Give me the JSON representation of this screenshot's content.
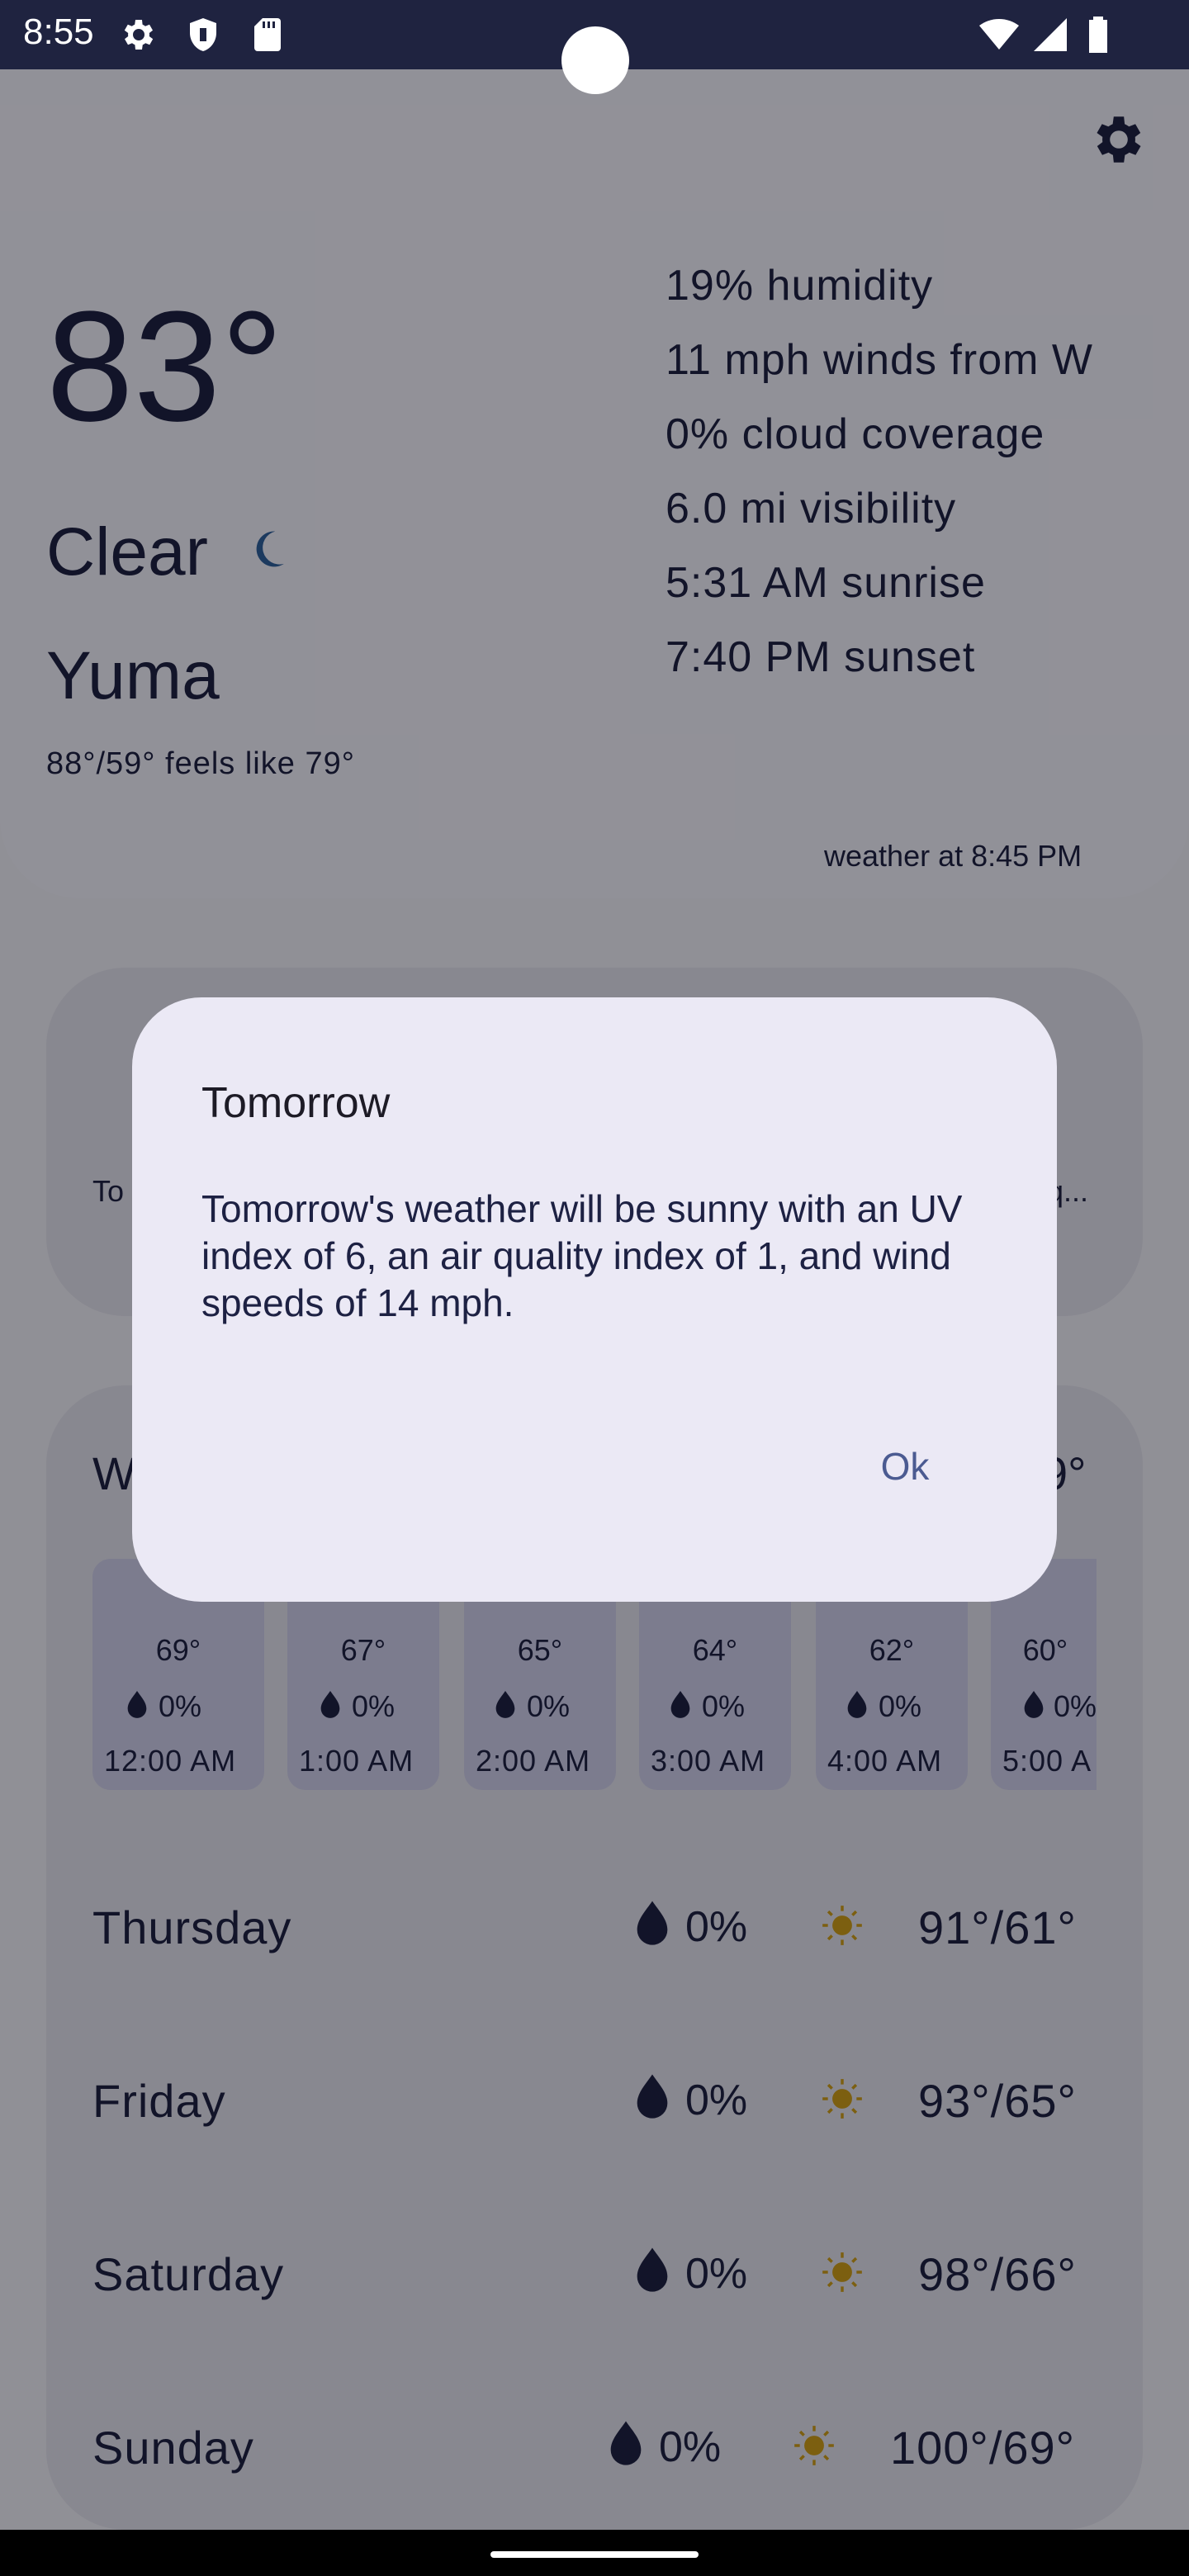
{
  "status_bar": {
    "time": "8:55",
    "left_icons": [
      "gear-icon",
      "shield-icon",
      "sd-card-icon"
    ],
    "right_icons": [
      "wifi-icon",
      "signal-icon",
      "battery-icon"
    ]
  },
  "current": {
    "temperature": "83°",
    "condition": "Clear",
    "condition_icon": "moon-icon",
    "city": "Yuma",
    "feels_like": "88°/59° feels like 79°",
    "details": [
      "19% humidity",
      "11 mph winds from W",
      "0% cloud coverage",
      "6.0 mi visibility",
      "5:31 AM sunrise",
      "7:40 PM sunset"
    ],
    "updated": "weather at 8:45 PM"
  },
  "middle_card": {
    "left_text": "To",
    "right_text": "q..."
  },
  "forecast": {
    "heading_left": "W",
    "heading_right": "9°",
    "hourly": [
      {
        "temp": "69°",
        "rain": "0%",
        "time": "12:00 AM"
      },
      {
        "temp": "67°",
        "rain": "0%",
        "time": "1:00 AM"
      },
      {
        "temp": "65°",
        "rain": "0%",
        "time": "2:00 AM"
      },
      {
        "temp": "64°",
        "rain": "0%",
        "time": "3:00 AM"
      },
      {
        "temp": "62°",
        "rain": "0%",
        "time": "4:00 AM"
      },
      {
        "temp": "60°",
        "rain": "0%",
        "time": "5:00 A"
      }
    ],
    "daily": [
      {
        "day": "Thursday",
        "rain": "0%",
        "icon": "sun-icon",
        "temps": "91°/61°"
      },
      {
        "day": "Friday",
        "rain": "0%",
        "icon": "sun-icon",
        "temps": "93°/65°"
      },
      {
        "day": "Saturday",
        "rain": "0%",
        "icon": "sun-icon",
        "temps": "98°/66°"
      },
      {
        "day": "Sunday",
        "rain": "0%",
        "icon": "sun-icon",
        "temps": "100°/69°"
      }
    ]
  },
  "dialog": {
    "title": "Tomorrow",
    "body": "Tomorrow's weather will be sunny with an UV index of 6, an air quality index of 1, and wind speeds of 14 mph.",
    "ok_label": "Ok"
  },
  "colors": {
    "accent": "#4b5b91",
    "text_dark": "#1d2143",
    "sun": "#c99a1a",
    "moon": "#2e5e9a"
  }
}
